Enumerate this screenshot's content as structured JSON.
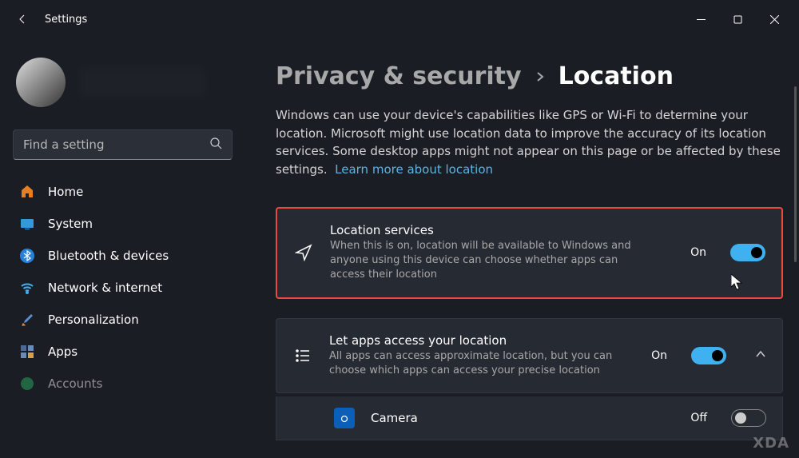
{
  "window": {
    "title": "Settings"
  },
  "search": {
    "placeholder": "Find a setting"
  },
  "nav": {
    "items": [
      {
        "label": "Home",
        "icon": "home"
      },
      {
        "label": "System",
        "icon": "system"
      },
      {
        "label": "Bluetooth & devices",
        "icon": "bluetooth"
      },
      {
        "label": "Network & internet",
        "icon": "wifi"
      },
      {
        "label": "Personalization",
        "icon": "brush"
      },
      {
        "label": "Apps",
        "icon": "apps"
      },
      {
        "label": "Accounts",
        "icon": "accounts"
      }
    ]
  },
  "breadcrumb": {
    "parent": "Privacy & security",
    "current": "Location"
  },
  "description": {
    "text": "Windows can use your device's capabilities like GPS or Wi-Fi to determine your location. Microsoft might use location data to improve the accuracy of its location services. Some desktop apps might not appear on this page or be affected by these settings.",
    "link": "Learn more about location"
  },
  "cards": {
    "location_services": {
      "title": "Location services",
      "desc": "When this is on, location will be available to Windows and anyone using this device can choose whether apps can access their location",
      "status": "On"
    },
    "apps_access": {
      "title": "Let apps access your location",
      "desc": "All apps can access approximate location, but you can choose which apps can access your precise location",
      "status": "On"
    },
    "camera": {
      "name": "Camera",
      "status": "Off"
    }
  },
  "watermark": "XDA"
}
